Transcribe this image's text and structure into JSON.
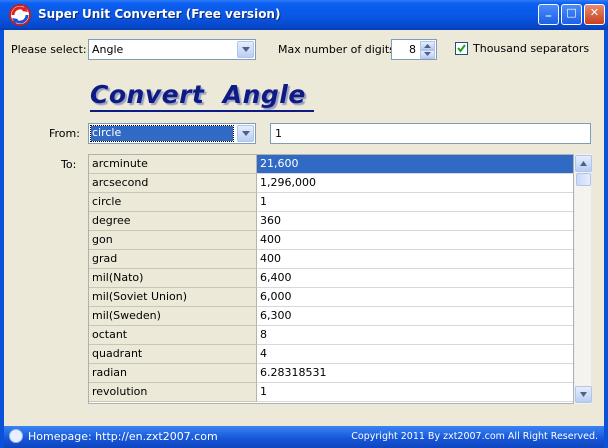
{
  "window": {
    "title": "Super Unit Converter (Free version)",
    "controls": [
      "minimize",
      "maximize",
      "close"
    ],
    "minimize_glyph": "_",
    "maximize_glyph": "□",
    "close_glyph": "✕"
  },
  "options": {
    "select_label": "Please select:",
    "category_value": "Angle",
    "max_digits_label": "Max number of digits:",
    "max_digits_value": "8",
    "thousand_sep_label": "Thousand separators",
    "thousand_sep_checked": true
  },
  "heading": {
    "text": "Convert  Angle  "
  },
  "from": {
    "label": "From:",
    "unit_value": "circle",
    "amount_value": "1"
  },
  "to": {
    "label": "To:",
    "rows": [
      {
        "unit": "arcminute",
        "value": "21,600",
        "selected": true
      },
      {
        "unit": "arcsecond",
        "value": "1,296,000"
      },
      {
        "unit": "circle",
        "value": "1"
      },
      {
        "unit": "degree",
        "value": "360"
      },
      {
        "unit": "gon",
        "value": "400"
      },
      {
        "unit": "grad",
        "value": "400"
      },
      {
        "unit": "mil(Nato)",
        "value": "6,400"
      },
      {
        "unit": "mil(Soviet Union)",
        "value": "6,000"
      },
      {
        "unit": "mil(Sweden)",
        "value": "6,300"
      },
      {
        "unit": "octant",
        "value": "8"
      },
      {
        "unit": "quadrant",
        "value": "4"
      },
      {
        "unit": "radian",
        "value": "6.28318531"
      },
      {
        "unit": "revolution",
        "value": "1"
      }
    ]
  },
  "status": {
    "homepage": "Homepage: http://en.zxt2007.com",
    "copyright": "Copyright 2011 By zxt2007.com All Right Reserved."
  },
  "colors": {
    "title_bar": "#0a58e6",
    "heading": "#0e1b84",
    "selection": "#316ac5",
    "client_bg": "#ece9d8"
  }
}
